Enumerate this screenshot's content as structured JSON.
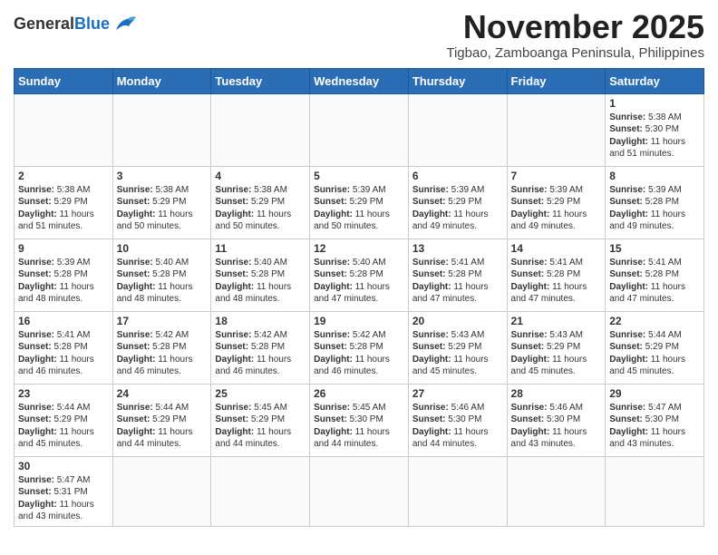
{
  "header": {
    "logo_general": "General",
    "logo_blue": "Blue",
    "month_title": "November 2025",
    "subtitle": "Tigbao, Zamboanga Peninsula, Philippines"
  },
  "weekdays": [
    "Sunday",
    "Monday",
    "Tuesday",
    "Wednesday",
    "Thursday",
    "Friday",
    "Saturday"
  ],
  "weeks": [
    [
      {
        "day": "",
        "info": ""
      },
      {
        "day": "",
        "info": ""
      },
      {
        "day": "",
        "info": ""
      },
      {
        "day": "",
        "info": ""
      },
      {
        "day": "",
        "info": ""
      },
      {
        "day": "",
        "info": ""
      },
      {
        "day": "1",
        "info": "Sunrise: 5:38 AM\nSunset: 5:30 PM\nDaylight: 11 hours and 51 minutes."
      }
    ],
    [
      {
        "day": "2",
        "info": "Sunrise: 5:38 AM\nSunset: 5:29 PM\nDaylight: 11 hours and 51 minutes."
      },
      {
        "day": "3",
        "info": "Sunrise: 5:38 AM\nSunset: 5:29 PM\nDaylight: 11 hours and 50 minutes."
      },
      {
        "day": "4",
        "info": "Sunrise: 5:38 AM\nSunset: 5:29 PM\nDaylight: 11 hours and 50 minutes."
      },
      {
        "day": "5",
        "info": "Sunrise: 5:39 AM\nSunset: 5:29 PM\nDaylight: 11 hours and 50 minutes."
      },
      {
        "day": "6",
        "info": "Sunrise: 5:39 AM\nSunset: 5:29 PM\nDaylight: 11 hours and 49 minutes."
      },
      {
        "day": "7",
        "info": "Sunrise: 5:39 AM\nSunset: 5:29 PM\nDaylight: 11 hours and 49 minutes."
      },
      {
        "day": "8",
        "info": "Sunrise: 5:39 AM\nSunset: 5:28 PM\nDaylight: 11 hours and 49 minutes."
      }
    ],
    [
      {
        "day": "9",
        "info": "Sunrise: 5:39 AM\nSunset: 5:28 PM\nDaylight: 11 hours and 48 minutes."
      },
      {
        "day": "10",
        "info": "Sunrise: 5:40 AM\nSunset: 5:28 PM\nDaylight: 11 hours and 48 minutes."
      },
      {
        "day": "11",
        "info": "Sunrise: 5:40 AM\nSunset: 5:28 PM\nDaylight: 11 hours and 48 minutes."
      },
      {
        "day": "12",
        "info": "Sunrise: 5:40 AM\nSunset: 5:28 PM\nDaylight: 11 hours and 47 minutes."
      },
      {
        "day": "13",
        "info": "Sunrise: 5:41 AM\nSunset: 5:28 PM\nDaylight: 11 hours and 47 minutes."
      },
      {
        "day": "14",
        "info": "Sunrise: 5:41 AM\nSunset: 5:28 PM\nDaylight: 11 hours and 47 minutes."
      },
      {
        "day": "15",
        "info": "Sunrise: 5:41 AM\nSunset: 5:28 PM\nDaylight: 11 hours and 47 minutes."
      }
    ],
    [
      {
        "day": "16",
        "info": "Sunrise: 5:41 AM\nSunset: 5:28 PM\nDaylight: 11 hours and 46 minutes."
      },
      {
        "day": "17",
        "info": "Sunrise: 5:42 AM\nSunset: 5:28 PM\nDaylight: 11 hours and 46 minutes."
      },
      {
        "day": "18",
        "info": "Sunrise: 5:42 AM\nSunset: 5:28 PM\nDaylight: 11 hours and 46 minutes."
      },
      {
        "day": "19",
        "info": "Sunrise: 5:42 AM\nSunset: 5:28 PM\nDaylight: 11 hours and 46 minutes."
      },
      {
        "day": "20",
        "info": "Sunrise: 5:43 AM\nSunset: 5:29 PM\nDaylight: 11 hours and 45 minutes."
      },
      {
        "day": "21",
        "info": "Sunrise: 5:43 AM\nSunset: 5:29 PM\nDaylight: 11 hours and 45 minutes."
      },
      {
        "day": "22",
        "info": "Sunrise: 5:44 AM\nSunset: 5:29 PM\nDaylight: 11 hours and 45 minutes."
      }
    ],
    [
      {
        "day": "23",
        "info": "Sunrise: 5:44 AM\nSunset: 5:29 PM\nDaylight: 11 hours and 45 minutes."
      },
      {
        "day": "24",
        "info": "Sunrise: 5:44 AM\nSunset: 5:29 PM\nDaylight: 11 hours and 44 minutes."
      },
      {
        "day": "25",
        "info": "Sunrise: 5:45 AM\nSunset: 5:29 PM\nDaylight: 11 hours and 44 minutes."
      },
      {
        "day": "26",
        "info": "Sunrise: 5:45 AM\nSunset: 5:30 PM\nDaylight: 11 hours and 44 minutes."
      },
      {
        "day": "27",
        "info": "Sunrise: 5:46 AM\nSunset: 5:30 PM\nDaylight: 11 hours and 44 minutes."
      },
      {
        "day": "28",
        "info": "Sunrise: 5:46 AM\nSunset: 5:30 PM\nDaylight: 11 hours and 43 minutes."
      },
      {
        "day": "29",
        "info": "Sunrise: 5:47 AM\nSunset: 5:30 PM\nDaylight: 11 hours and 43 minutes."
      }
    ],
    [
      {
        "day": "30",
        "info": "Sunrise: 5:47 AM\nSunset: 5:31 PM\nDaylight: 11 hours and 43 minutes."
      },
      {
        "day": "",
        "info": ""
      },
      {
        "day": "",
        "info": ""
      },
      {
        "day": "",
        "info": ""
      },
      {
        "day": "",
        "info": ""
      },
      {
        "day": "",
        "info": ""
      },
      {
        "day": "",
        "info": ""
      }
    ]
  ]
}
